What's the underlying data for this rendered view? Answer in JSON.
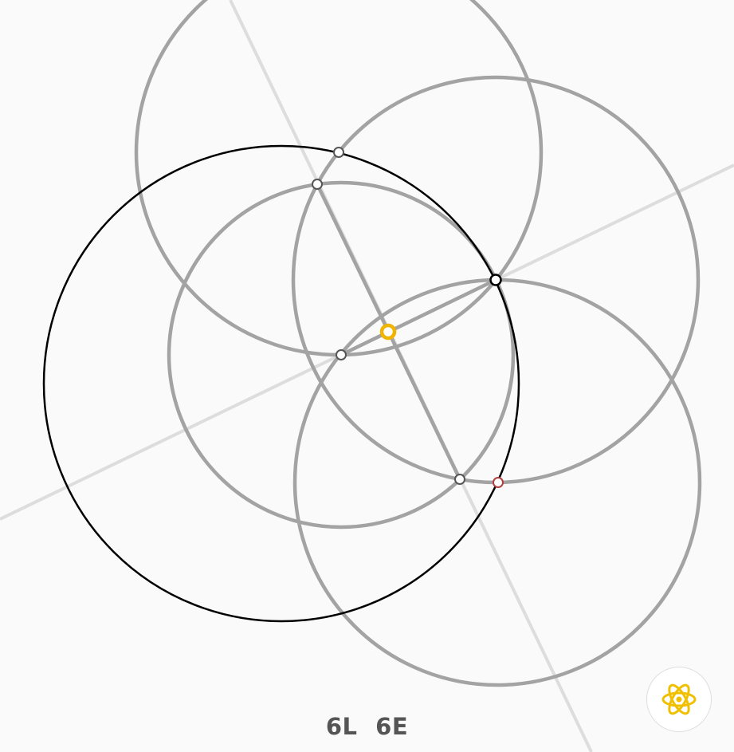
{
  "game": {
    "moves": {
      "lines_count": "6L",
      "euclid_count": "6E"
    },
    "hint_icon": "atom-icon",
    "colors": {
      "background": "#fafafa",
      "construction_circle": "#a3a3a3",
      "construction_line": "#a3a3a3",
      "faint_line": "#dddddd",
      "target_circle": "#000000",
      "point_fill": "#ffffff",
      "point_stroke": "#555555",
      "center_point": "#f0b400",
      "target_point": "#b04040",
      "hint_icon": "#f0c000"
    }
  }
}
